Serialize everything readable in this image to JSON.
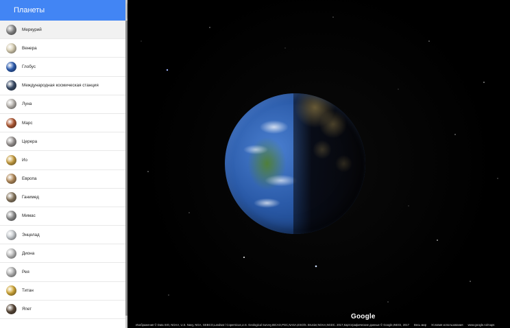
{
  "sidebar": {
    "title": "Планеты",
    "items": [
      {
        "label": "Меркурий",
        "icon": "mercury-icon",
        "color": "#8a8a8a",
        "selected": true
      },
      {
        "label": "Венера",
        "icon": "venus-icon",
        "color": "#d8cfb4"
      },
      {
        "label": "Глобус",
        "icon": "earth-icon",
        "color": "#2f5fb3"
      },
      {
        "label": "Международная космическая станция",
        "icon": "iss-icon",
        "color": "#3d4f6a"
      },
      {
        "label": "Луна",
        "icon": "moon-icon",
        "color": "#b9b5b0"
      },
      {
        "label": "Марс",
        "icon": "mars-icon",
        "color": "#b05a35"
      },
      {
        "label": "Церера",
        "icon": "ceres-icon",
        "color": "#9b9694"
      },
      {
        "label": "Ио",
        "icon": "io-icon",
        "color": "#c9a043"
      },
      {
        "label": "Европа",
        "icon": "europa-icon",
        "color": "#b48c5c"
      },
      {
        "label": "Ганимед",
        "icon": "ganymede-icon",
        "color": "#8b7b63"
      },
      {
        "label": "Мимас",
        "icon": "mimas-icon",
        "color": "#8f8f8f"
      },
      {
        "label": "Энцелад",
        "icon": "enceladus-icon",
        "color": "#c8ccd0"
      },
      {
        "label": "Диона",
        "icon": "dione-icon",
        "color": "#bdbdbd"
      },
      {
        "label": "Рея",
        "icon": "rhea-icon",
        "color": "#b3b3b3"
      },
      {
        "label": "Титан",
        "icon": "titan-icon",
        "color": "#d2a93a"
      },
      {
        "label": "Япет",
        "icon": "iapetus-icon",
        "color": "#5b4a3a"
      }
    ]
  },
  "map": {
    "logo": "Google",
    "attribution": "Изображения © Data SIO, NOAA, U.S. Navy, NGA, GEBCO,Landsat / Copernicus,U.S. Geological Survey,IBCAO,PGC,NASA,ESO/S. Brunier,NOAA,NGDC. 2017,Картографические данные © Google,INEGI, 2017",
    "world_link": "Весь мир",
    "terms_link": "Условия использования",
    "url_text": "www.google.ru/maps"
  },
  "colors": {
    "header": "#4285f4",
    "space": "#000000"
  }
}
